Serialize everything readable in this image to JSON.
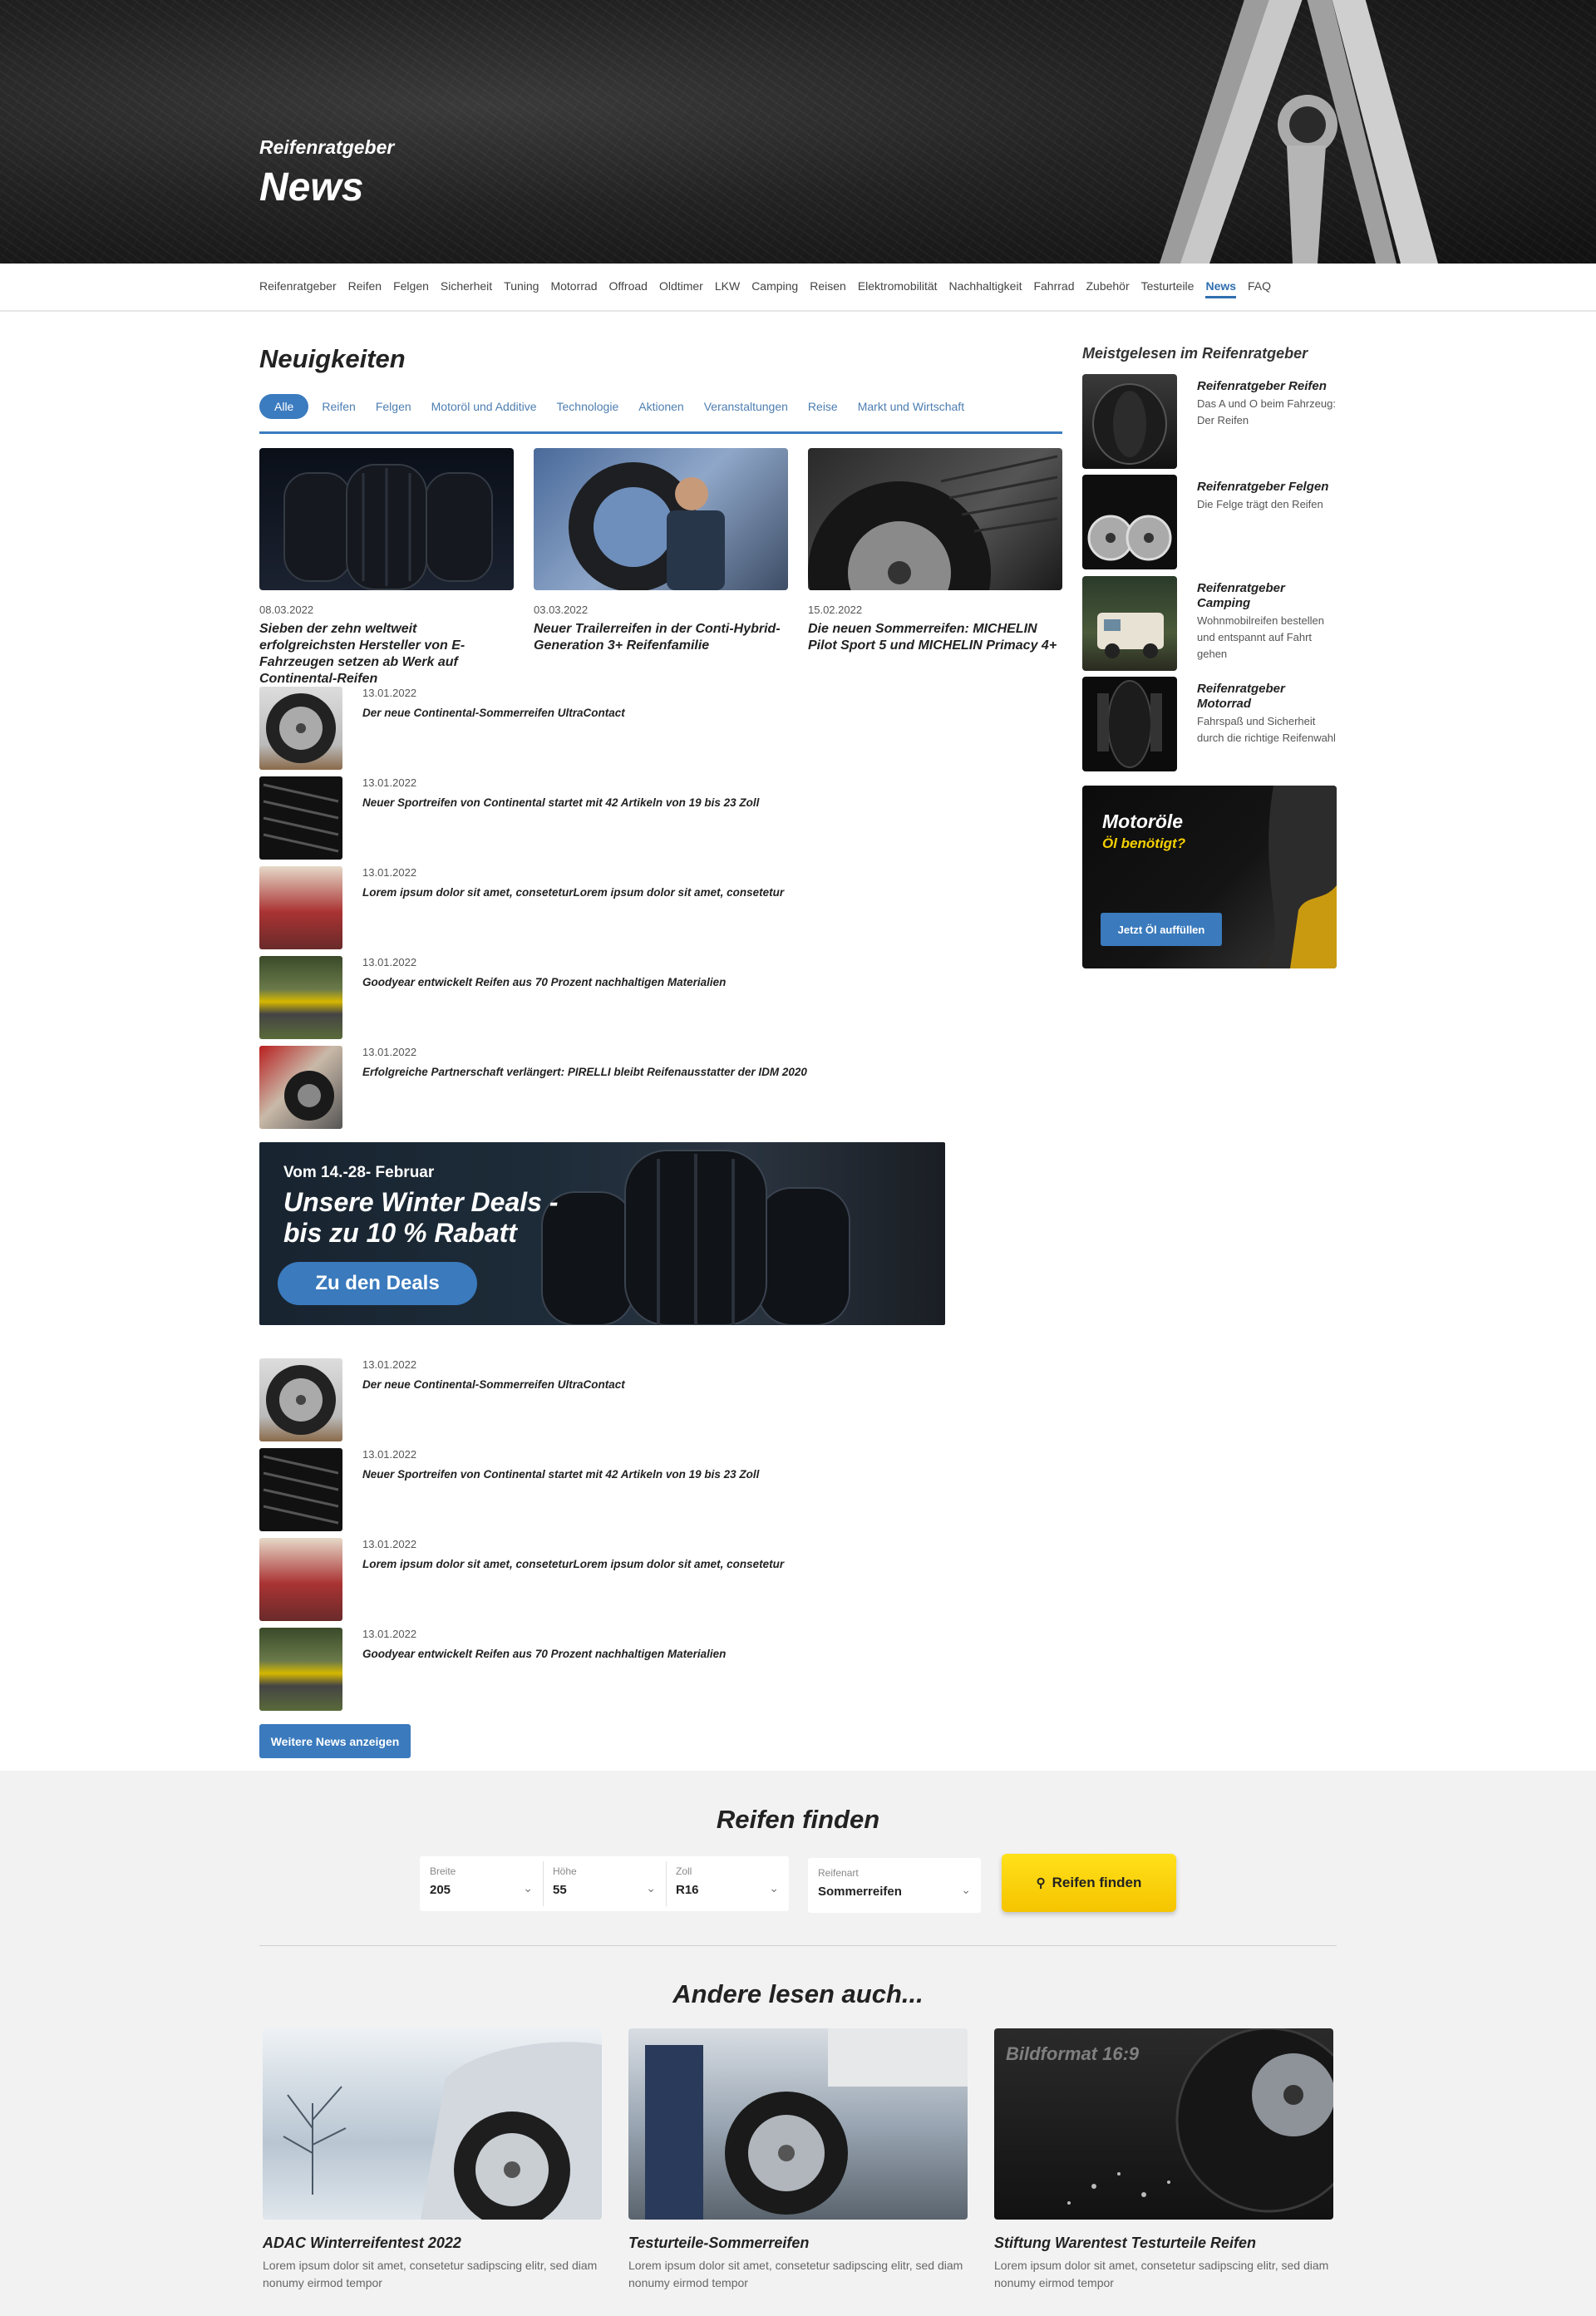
{
  "hero": {
    "subtitle": "Reifenratgeber",
    "title": "News"
  },
  "nav": {
    "items": [
      "Reifenratgeber",
      "Reifen",
      "Felgen",
      "Sicherheit",
      "Tuning",
      "Motorrad",
      "Offroad",
      "Oldtimer",
      "LKW",
      "Camping",
      "Reisen",
      "Elektromobilität",
      "Nachhaltigkeit",
      "Fahrrad",
      "Zubehör",
      "Testurteile",
      "News",
      "FAQ"
    ],
    "active": "News"
  },
  "main": {
    "title": "Neuigkeiten",
    "filters": [
      "Alle",
      "Reifen",
      "Felgen",
      "Motoröl und Additive",
      "Technologie",
      "Aktionen",
      "Veranstaltungen",
      "Reise",
      "Markt und Wirtschaft"
    ],
    "featured": [
      {
        "date": "08.03.2022",
        "title": "Sieben der zehn weltweit erfolgreichsten Hersteller von E-Fahrzeugen setzen ab Werk auf Continental-Reifen"
      },
      {
        "date": "03.03.2022",
        "title": "Neuer Trailerreifen in der Conti-Hybrid-Generation 3+ Reifenfamilie"
      },
      {
        "date": "15.02.2022",
        "title": "Die neuen Sommerreifen: MICHELIN Pilot Sport 5 und MICHELIN Primacy 4+"
      }
    ],
    "list1": [
      {
        "date": "13.01.2022",
        "title": "Der neue Continental-Sommerreifen UltraContact"
      },
      {
        "date": "13.01.2022",
        "title": "Neuer Sportreifen von Continental startet mit 42 Artikeln von 19 bis 23 Zoll"
      },
      {
        "date": "13.01.2022",
        "title": "Lorem ipsum dolor sit amet, conseteturLorem ipsum dolor sit amet, consetetur"
      },
      {
        "date": "13.01.2022",
        "title": "Goodyear entwickelt Reifen aus 70 Prozent nachhaltigen Materialien"
      },
      {
        "date": "13.01.2022",
        "title": "Erfolgreiche Partnerschaft verlängert: PIRELLI bleibt Reifenausstatter der IDM 2020"
      }
    ],
    "promo": {
      "line1": "Vom 14.-28- Februar",
      "line2": "Unsere Winter Deals - bis zu 10 % Rabatt",
      "button": "Zu den Deals"
    },
    "list2": [
      {
        "date": "13.01.2022",
        "title": "Der neue Continental-Sommerreifen UltraContact"
      },
      {
        "date": "13.01.2022",
        "title": "Neuer Sportreifen von Continental startet mit 42 Artikeln von 19 bis 23 Zoll"
      },
      {
        "date": "13.01.2022",
        "title": "Lorem ipsum dolor sit amet, conseteturLorem ipsum dolor sit amet, consetetur"
      },
      {
        "date": "13.01.2022",
        "title": "Goodyear entwickelt Reifen aus 70 Prozent nachhaltigen Materialien"
      }
    ],
    "more_button": "Weitere News anzeigen"
  },
  "sidebar": {
    "title": "Meistgelesen im Reifenratgeber",
    "items": [
      {
        "title": "Reifenratgeber Reifen",
        "desc": "Das A und O beim Fahrzeug: Der Reifen"
      },
      {
        "title": "Reifenratgeber Felgen",
        "desc": "Die Felge trägt den Reifen"
      },
      {
        "title": "Reifenratgeber Camping",
        "desc": "Wohnmobilreifen bestellen und entspannt auf Fahrt gehen"
      },
      {
        "title": "Reifenratgeber Motorrad",
        "desc": "Fahrspaß und Sicherheit durch die richtige Reifenwahl"
      }
    ],
    "oil": {
      "title": "Motoröle",
      "subtitle": "Öl benötigt?",
      "button": "Jetzt Öl auffüllen"
    }
  },
  "finder": {
    "title": "Reifen finden",
    "fields": [
      {
        "label": "Breite",
        "value": "205"
      },
      {
        "label": "Höhe",
        "value": "55"
      },
      {
        "label": "Zoll",
        "value": "R16"
      },
      {
        "label": "Reifenart",
        "value": "Sommerreifen"
      }
    ],
    "button": "Reifen finden"
  },
  "others": {
    "title": "Andere lesen auch...",
    "cards": [
      {
        "title": "ADAC Winterreifentest 2022",
        "desc": "Lorem ipsum dolor sit amet, consetetur sadipscing elitr, sed diam nonumy eirmod tempor"
      },
      {
        "title": "Testurteile-Sommerreifen",
        "desc": "Lorem ipsum dolor sit amet, consetetur sadipscing elitr, sed diam nonumy eirmod tempor"
      },
      {
        "title": "Stiftung Warentest Testurteile Reifen",
        "desc": "Lorem ipsum dolor sit amet, consetetur sadipscing elitr, sed diam nonumy eirmod tempor"
      }
    ],
    "watermark": "Bildformat 16:9"
  },
  "colors": {
    "accent": "#3a7abd",
    "yellow": "#f5c400",
    "finder_bg": "#f2f2f2"
  }
}
